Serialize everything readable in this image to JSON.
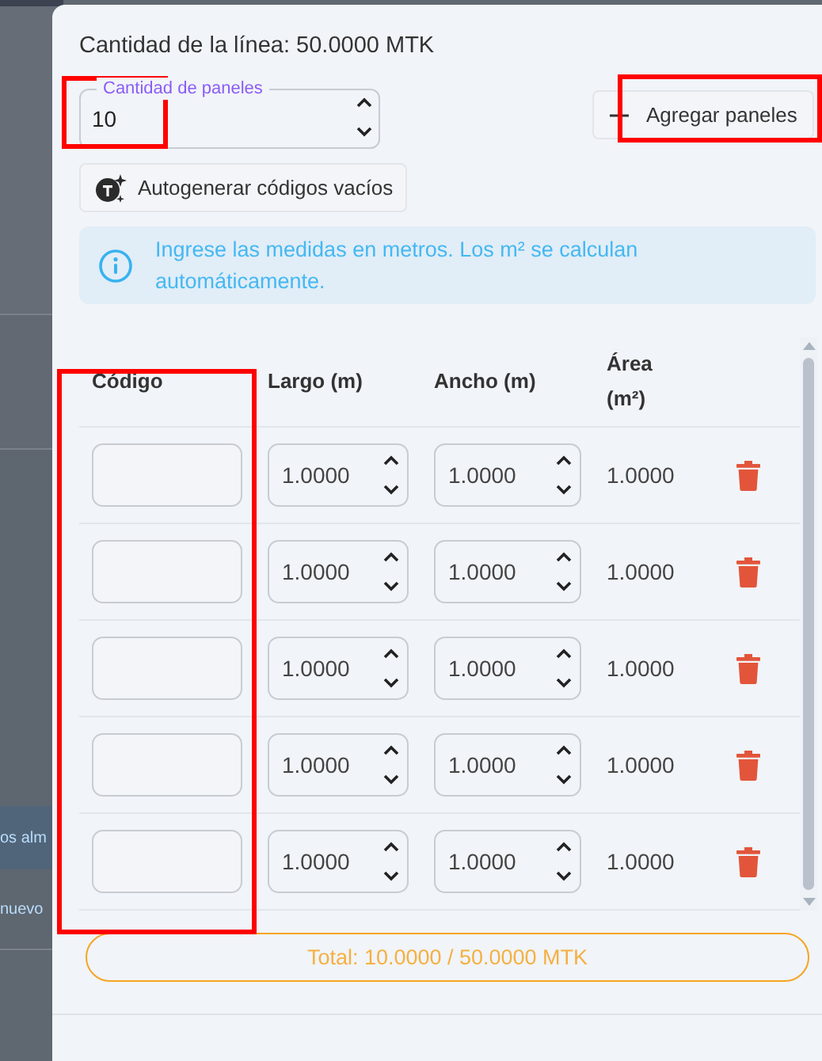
{
  "backdrop": {
    "texts": [
      "os alm",
      "nuevo"
    ]
  },
  "dialog": {
    "line_quantity": "Cantidad de la línea: 50.0000 MTK",
    "panel_count": {
      "label": "Cantidad de paneles",
      "value": "10",
      "highlighted": true
    },
    "add_button": {
      "label": "Agregar paneles",
      "highlighted": true
    },
    "autogen_button": {
      "label": "Autogenerar códigos vacíos"
    },
    "info": "Ingrese las medidas en metros. Los m² se calculan automáticamente.",
    "table": {
      "columns": [
        {
          "label": "Código",
          "highlighted": true
        },
        {
          "label": "Largo (m)",
          "highlighted": false
        },
        {
          "label": "Ancho (m)",
          "highlighted": false
        },
        {
          "label": "Área (m²)",
          "highlighted": false
        }
      ],
      "rows": [
        {
          "largo": "1.0000",
          "ancho": "1.0000",
          "area": "1.0000"
        },
        {
          "largo": "1.0000",
          "ancho": "1.0000",
          "area": "1.0000"
        },
        {
          "largo": "1.0000",
          "ancho": "1.0000",
          "area": "1.0000"
        },
        {
          "largo": "1.0000",
          "ancho": "1.0000",
          "area": "1.0000"
        },
        {
          "largo": "1.0000",
          "ancho": "1.0000",
          "area": "1.0000"
        }
      ]
    },
    "total": "Total: 10.0000 / 50.0000 MTK"
  }
}
